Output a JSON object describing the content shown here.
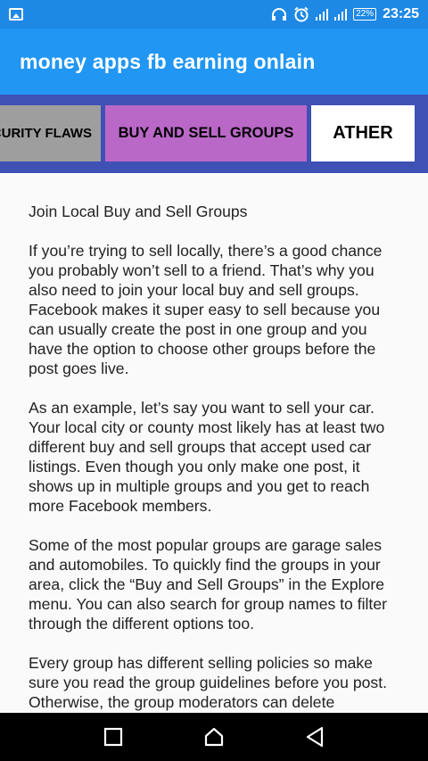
{
  "status_bar": {
    "battery": "22%",
    "time": "23:25"
  },
  "app_bar": {
    "title": "money apps fb earning onlain"
  },
  "tabs": [
    {
      "label": "SECURITY FLAWS"
    },
    {
      "label": "BUY AND SELL GROUPS"
    },
    {
      "label": "ATHER"
    }
  ],
  "article": {
    "heading": "Join Local Buy and Sell Groups",
    "paragraphs": [
      "If you’re trying to sell locally, there’s a good chance you probably won’t sell to a friend. That’s why you also need to join your local buy and sell groups. Facebook makes it super easy to sell because you can usually create the post in one group and you have the option to choose other groups before the post goes live.",
      "As an example, let’s say you want to sell your car. Your local city or county most likely has at least two different buy and sell groups that accept used car listings. Even though you only make one post, it shows up in multiple groups and you get to reach more Facebook members.",
      "Some of the most popular groups are garage sales and automobiles. To quickly find the groups in your area, click the “Buy and Sell Groups” in the Explore menu. You can also search for group names to filter through the different options too.",
      "Every group has different selling policies so make sure you read the group guidelines before you post. Otherwise, the group moderators can delete"
    ]
  },
  "icons": {
    "status_left": "image-icon",
    "headset": "headset-icon",
    "alarm": "alarm-icon",
    "signal": "signal-icon",
    "battery": "battery-icon",
    "nav_recent": "square-icon",
    "nav_home": "home-icon",
    "nav_back": "back-triangle-icon"
  },
  "colors": {
    "status_bar": "#1e88e5",
    "app_bar": "#2196f3",
    "tab_strip": "#3f51b5",
    "tab_inactive": "#9e9e9e",
    "tab_selected_accent": "#ba68c8"
  }
}
